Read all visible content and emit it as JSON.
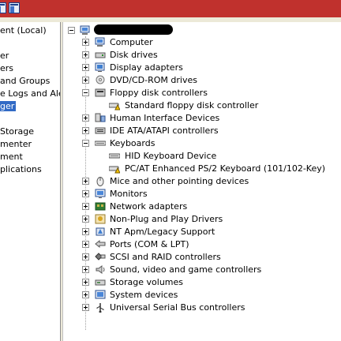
{
  "left_pane": {
    "items": [
      {
        "label": "ent (Local)",
        "selected": false
      },
      {
        "label": "er",
        "selected": false
      },
      {
        "label": "ers",
        "selected": false
      },
      {
        "label": "and Groups",
        "selected": false
      },
      {
        "label": "e Logs and Alert",
        "selected": false
      },
      {
        "label": "ger",
        "selected": true
      },
      {
        "label": "Storage",
        "selected": false
      },
      {
        "label": "menter",
        "selected": false
      },
      {
        "label": "ment",
        "selected": false
      },
      {
        "label": "plications",
        "selected": false
      }
    ]
  },
  "device_tree": {
    "root_label": "",
    "categories": [
      {
        "label": "Computer",
        "icon": "computer-icon"
      },
      {
        "label": "Disk drives",
        "icon": "disk-drive-icon"
      },
      {
        "label": "Display adapters",
        "icon": "display-adapter-icon"
      },
      {
        "label": "DVD/CD-ROM drives",
        "icon": "cdrom-icon"
      },
      {
        "label": "Floppy disk controllers",
        "icon": "floppy-controller-icon",
        "children": [
          "Standard floppy disk controller"
        ]
      },
      {
        "label": "Human Interface Devices",
        "icon": "hid-icon"
      },
      {
        "label": "IDE ATA/ATAPI controllers",
        "icon": "ide-controller-icon"
      },
      {
        "label": "Keyboards",
        "icon": "keyboard-icon",
        "children": [
          "HID Keyboard Device",
          "PC/AT Enhanced PS/2 Keyboard (101/102-Key)"
        ]
      },
      {
        "label": "Mice and other pointing devices",
        "icon": "mouse-icon"
      },
      {
        "label": "Monitors",
        "icon": "monitor-icon"
      },
      {
        "label": "Network adapters",
        "icon": "network-adapter-icon"
      },
      {
        "label": "Non-Plug and Play Drivers",
        "icon": "driver-icon"
      },
      {
        "label": "NT Apm/Legacy Support",
        "icon": "apm-icon"
      },
      {
        "label": "Ports (COM & LPT)",
        "icon": "port-icon"
      },
      {
        "label": "SCSI and RAID controllers",
        "icon": "scsi-icon"
      },
      {
        "label": "Sound, video and game controllers",
        "icon": "sound-icon"
      },
      {
        "label": "Storage volumes",
        "icon": "storage-volume-icon"
      },
      {
        "label": "System devices",
        "icon": "system-device-icon"
      },
      {
        "label": "Universal Serial Bus controllers",
        "icon": "usb-icon"
      }
    ]
  },
  "colors": {
    "titlebar": "#c0312d",
    "selection": "#316ac5"
  }
}
